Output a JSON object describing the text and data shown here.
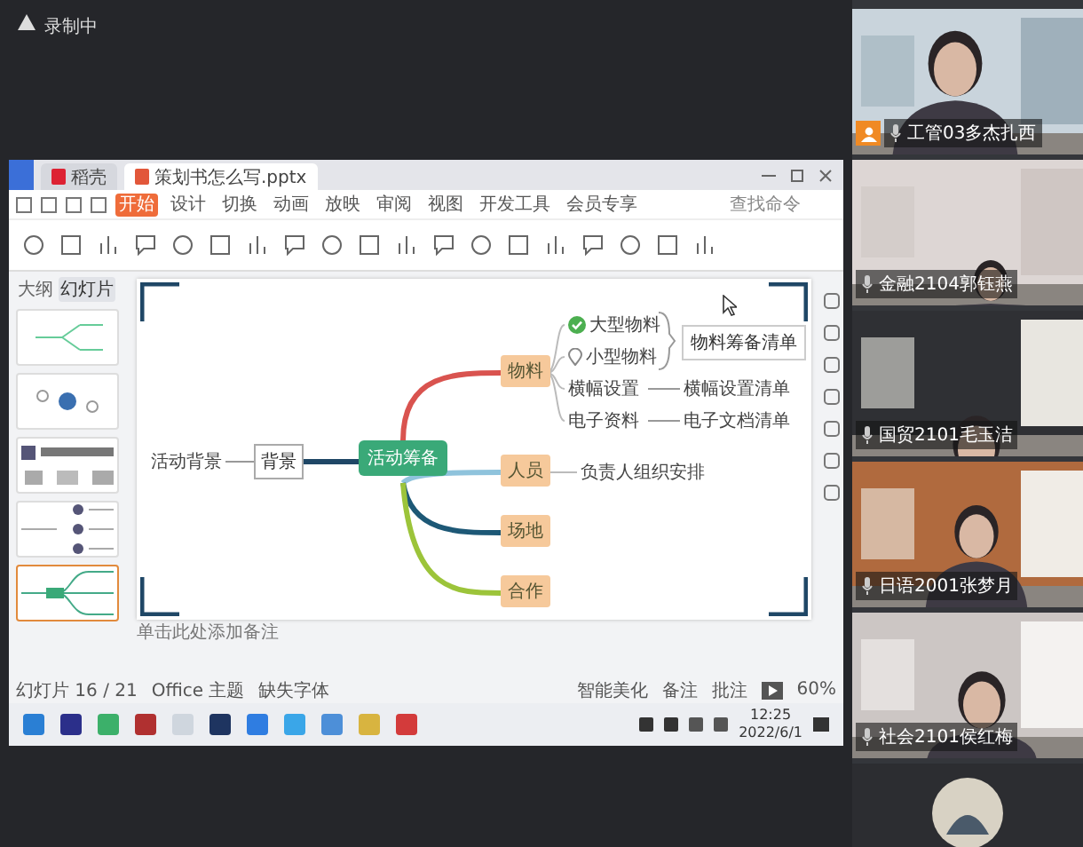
{
  "recording": {
    "label": "录制中"
  },
  "app": {
    "tabs": [
      {
        "label": "稻壳",
        "selected": false
      },
      {
        "label": "策划书怎么写.pptx",
        "selected": true
      }
    ],
    "menu": [
      {
        "label": "开始",
        "selected": true
      },
      {
        "label": "设计",
        "selected": false
      },
      {
        "label": "切换",
        "selected": false
      },
      {
        "label": "动画",
        "selected": false
      },
      {
        "label": "放映",
        "selected": false
      },
      {
        "label": "审阅",
        "selected": false
      },
      {
        "label": "视图",
        "selected": false
      },
      {
        "label": "开发工具",
        "selected": false
      },
      {
        "label": "会员专享",
        "selected": false
      }
    ],
    "search": {
      "placeholder": "查找命令"
    },
    "panel_tabs": [
      {
        "label": "大纲",
        "selected": false
      },
      {
        "label": "幻灯片",
        "selected": true
      }
    ],
    "thumbnails": [
      {
        "selected": false
      },
      {
        "selected": false
      },
      {
        "selected": false
      },
      {
        "selected": false
      },
      {
        "selected": true
      }
    ]
  },
  "mindmap": {
    "center": "活动筹备",
    "left": {
      "label": "背景",
      "note": "活动背景"
    },
    "branches": [
      {
        "label": "物料",
        "color": "#d9534f",
        "leaves": [
          {
            "kind": "group",
            "summary": "物料筹备清单",
            "items": [
              {
                "kind": "check",
                "label": "大型物料"
              },
              {
                "kind": "pin",
                "label": "小型物料"
              }
            ]
          },
          {
            "kind": "plain",
            "label": "横幅设置",
            "detail": "横幅设置清单"
          },
          {
            "kind": "plain",
            "label": "电子资料",
            "detail": "电子文档清单"
          }
        ]
      },
      {
        "label": "人员",
        "color": "#8fc3dc",
        "leaves": [
          {
            "kind": "plain",
            "label": "负责人组织安排"
          }
        ]
      },
      {
        "label": "场地",
        "color": "#1d5876"
      },
      {
        "label": "合作",
        "color": "#9cc43a"
      }
    ]
  },
  "notes": {
    "placeholder": "单击此处添加备注"
  },
  "status": {
    "slide": "幻灯片 16 / 21",
    "theme": "Office 主题",
    "font": "缺失字体",
    "beautify": "智能美化",
    "notes": "备注",
    "comments": "批注",
    "zoom": "60%"
  },
  "taskbar": {
    "time": "12:25",
    "date": "2022/6/1"
  },
  "participants": [
    {
      "kind": "camera",
      "name": "工管03多杰扎西",
      "host": true
    },
    {
      "kind": "camera",
      "name": "金融2104郭钰燕",
      "host": false
    },
    {
      "kind": "camera",
      "name": "国贸2101毛玉洁",
      "host": false
    },
    {
      "kind": "camera",
      "name": "日语2001张梦月",
      "host": false
    },
    {
      "kind": "camera",
      "name": "社会2101侯红梅",
      "host": false
    },
    {
      "kind": "avatar"
    }
  ]
}
